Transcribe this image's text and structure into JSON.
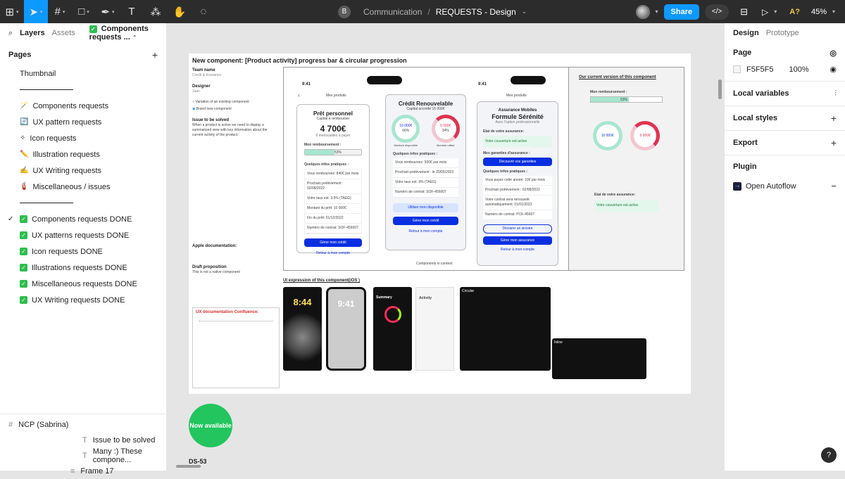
{
  "toolbar": {
    "project": "Communication",
    "separator": "/",
    "file": "REQUESTS - Design",
    "avatar_letter": "B",
    "share_label": "Share",
    "ai_label": "A?",
    "zoom": "45%"
  },
  "left_panel": {
    "tab_layers": "Layers",
    "tab_assets": "Assets",
    "current_page": "Components requests ...",
    "pages_header": "Pages",
    "pages": [
      {
        "label": "Thumbnail",
        "emoji": "",
        "done": false,
        "selected": false
      },
      {
        "label": "",
        "divider": true
      },
      {
        "label": "Components requests",
        "emoji": "🪄",
        "done": false
      },
      {
        "label": "UX pattern requests",
        "emoji": "🔄",
        "done": false
      },
      {
        "label": "Icon requests",
        "emoji": "✧",
        "done": false
      },
      {
        "label": "Illustration requests",
        "emoji": "✏️",
        "done": false
      },
      {
        "label": "UX Writing requests",
        "emoji": "✍️",
        "done": false
      },
      {
        "label": "Miscellaneous / issues",
        "emoji": "🧯",
        "done": false
      },
      {
        "label": "",
        "divider": true
      },
      {
        "label": "Components requests DONE",
        "done": true,
        "selected": true
      },
      {
        "label": "UX patterns requests DONE",
        "done": true
      },
      {
        "label": "Icon requests DONE",
        "done": true
      },
      {
        "label": "Illustrations requests DONE",
        "done": true
      },
      {
        "label": "Miscellaneous requests DONE",
        "done": true
      },
      {
        "label": "UX Writing requests DONE",
        "done": true
      }
    ],
    "layers": {
      "frame_name": "NCP (Sabrina)",
      "text_1": "Issue to be solved",
      "text_2": "Many :) These compone...",
      "frame_17": "Frame 17"
    }
  },
  "right_panel": {
    "tab_design": "Design",
    "tab_prototype": "Prototype",
    "page_label": "Page",
    "page_color": "F5F5F5",
    "page_opacity": "100%",
    "local_variables": "Local variables",
    "local_styles": "Local styles",
    "export": "Export",
    "plugin": "Plugin",
    "plugin_name": "Open Autoflow"
  },
  "canvas": {
    "frame_title": "New component: [Product activity]  progress bar  & circular progression",
    "team_name_label": "Team name",
    "team_name_value": "Credit & insurance",
    "designer_label": "Designer",
    "designer_value": "Juan",
    "radio_1": "Variation of an existing component",
    "radio_2": "Brand new component",
    "issue_label": "Issue to be solved",
    "issue_text": "When a product is active we need to display a summarized view with key information about the current activity of the product.",
    "apple_doc_label": "Apple documentation:",
    "draft_label": "Draft proposition",
    "draft_text": "This is not a native component",
    "ux_doc_label": "UX documentation Confluence:",
    "current_version_title": "Our current version of this component",
    "ui_expression_title": "UI expression of this component(iOS )",
    "phone_time": "9:41",
    "mes_produits": "Mes produits",
    "pret_title": "Prêt personnel",
    "pret_sub": "Capital à rembourser",
    "pret_amount": "4 700€",
    "pret_note": "6 mensualités à payer",
    "mon_remboursement": "Mon remboursement :",
    "progress_pct": "53%",
    "progress_value": 0.53,
    "quelques_infos": "Quelques infos pratiques :",
    "pret_rows": [
      "Vous remboursez: 840€ par mois",
      "Prochain prélèvement : 02/08/2022",
      "Votre taux est: 3.5% (TAEG)",
      "Montant du prêt: 10 000€",
      "Fin du prêt: 01/12/2022",
      "Numéro de contrat: SOF-456007"
    ],
    "gerer_credit": "Gérer mon crédit",
    "retour_compte": "Retour à mon compte",
    "credit_title": "Crédit Renouvelable",
    "credit_sub": "Capital accordé 15 000€",
    "ring_1_value": "10 000€",
    "ring_1_pct": "66%",
    "ring_1_label": "Montant disponible",
    "ring_2_value": "5 000€",
    "ring_2_pct": "34%",
    "ring_2_label": "Montant utilisé",
    "credit_rows": [
      "Vous remboursez: 500€ par mois",
      "Prochain prélèvement : le 20/05/2023",
      "Votre taux est: 9% (TAEG)",
      "Numéro de contrat: SOF-456007"
    ],
    "utiliser_label": "Utiliser mon disponible",
    "assurance_title": "Assurance Mobiles",
    "assurance_name": "Formule Sérénité",
    "assurance_sub": "Avec l'option professionnelle",
    "etat_label": "Etat de votre assurance:",
    "couverture": "Votre couverture est active",
    "garanties_label": "Mes garanties d'assurance :",
    "decouvrir": "Découvrir vos garanties",
    "assurance_rows": [
      "Vous payez cette année: 10€ par mois",
      "Prochain prélèvement : 02/08/2022",
      "Votre contrat sera renouvelé automatiquement: 01/01/2023",
      "Numéro de contrat: PCK-45607"
    ],
    "declarer": "Déclarer un sinistre",
    "gerer_assurance": "Gérer mon assurance",
    "components_context": "Components in context",
    "circular_label": "Circular",
    "inline_label": "Inline",
    "lock_time": "8:44",
    "lock_time_2": "9:41",
    "summary": "Summary",
    "activity": "Activity",
    "now_available": "Now available",
    "ds_label": "DS-53"
  }
}
